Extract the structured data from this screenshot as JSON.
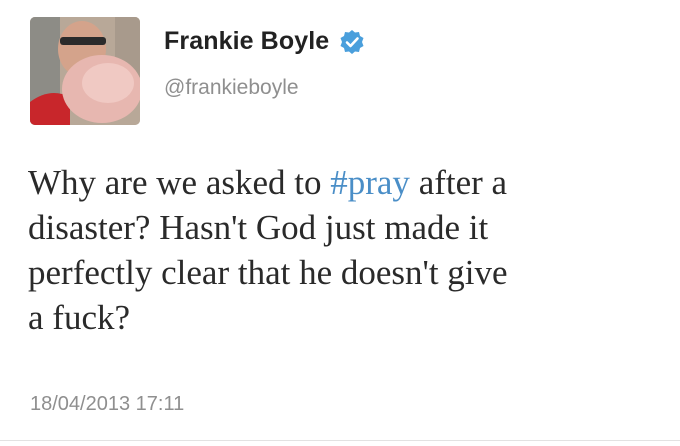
{
  "author": {
    "display_name": "Frankie Boyle",
    "handle": "@frankieboyle",
    "verified": true,
    "verified_icon": "verified-badge-icon",
    "verified_color": "#4a9fdc"
  },
  "tweet": {
    "text_before": "Why are we asked to ",
    "hashtag": "#pray",
    "text_after": " after a\ndisaster? Hasn't God just made it\nperfectly clear that he doesn't give\na fuck?",
    "hashtag_color": "#4a8ec7",
    "timestamp": "18/04/2013 17:11"
  }
}
